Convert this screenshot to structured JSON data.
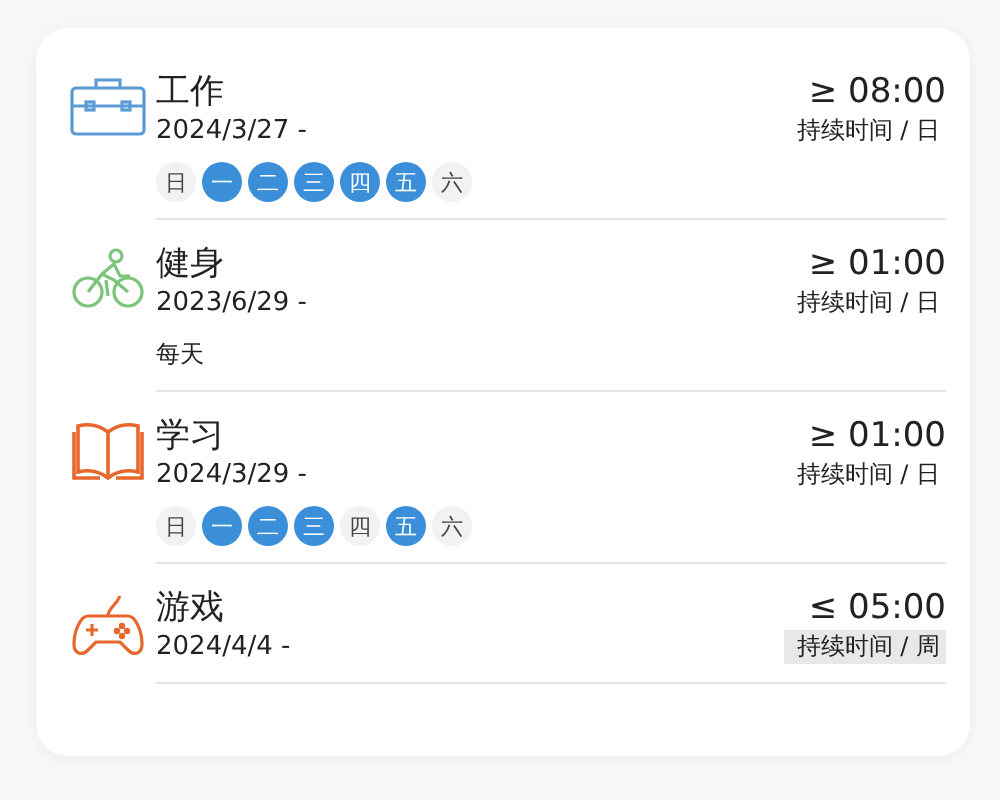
{
  "habits": [
    {
      "name": "工作",
      "start": "2024/3/27 -",
      "color": "#5b9bd5",
      "goal": "≥ 08:00",
      "period": "持续时间 / 日",
      "period_highlighted": false,
      "days": [
        {
          "label": "日",
          "selected": false
        },
        {
          "label": "一",
          "selected": true
        },
        {
          "label": "二",
          "selected": true
        },
        {
          "label": "三",
          "selected": true
        },
        {
          "label": "四",
          "selected": true
        },
        {
          "label": "五",
          "selected": true
        },
        {
          "label": "六",
          "selected": false
        }
      ]
    },
    {
      "name": "健身",
      "start": "2023/6/29 -",
      "color": "#7cc47a",
      "goal": "≥ 01:00",
      "period": "持续时间 / 日",
      "period_highlighted": false,
      "repeat": "每天"
    },
    {
      "name": "学习",
      "start": "2024/3/29 -",
      "color": "#e8672c",
      "goal": "≥ 01:00",
      "period": "持续时间 / 日",
      "period_highlighted": false,
      "days": [
        {
          "label": "日",
          "selected": false
        },
        {
          "label": "一",
          "selected": true
        },
        {
          "label": "二",
          "selected": true
        },
        {
          "label": "三",
          "selected": true
        },
        {
          "label": "四",
          "selected": false
        },
        {
          "label": "五",
          "selected": true
        },
        {
          "label": "六",
          "selected": false
        }
      ]
    },
    {
      "name": "游戏",
      "start": "2024/4/4 -",
      "color": "#e8672c",
      "goal": "≤ 05:00",
      "period": "持续时间 / 周",
      "period_highlighted": true
    }
  ]
}
